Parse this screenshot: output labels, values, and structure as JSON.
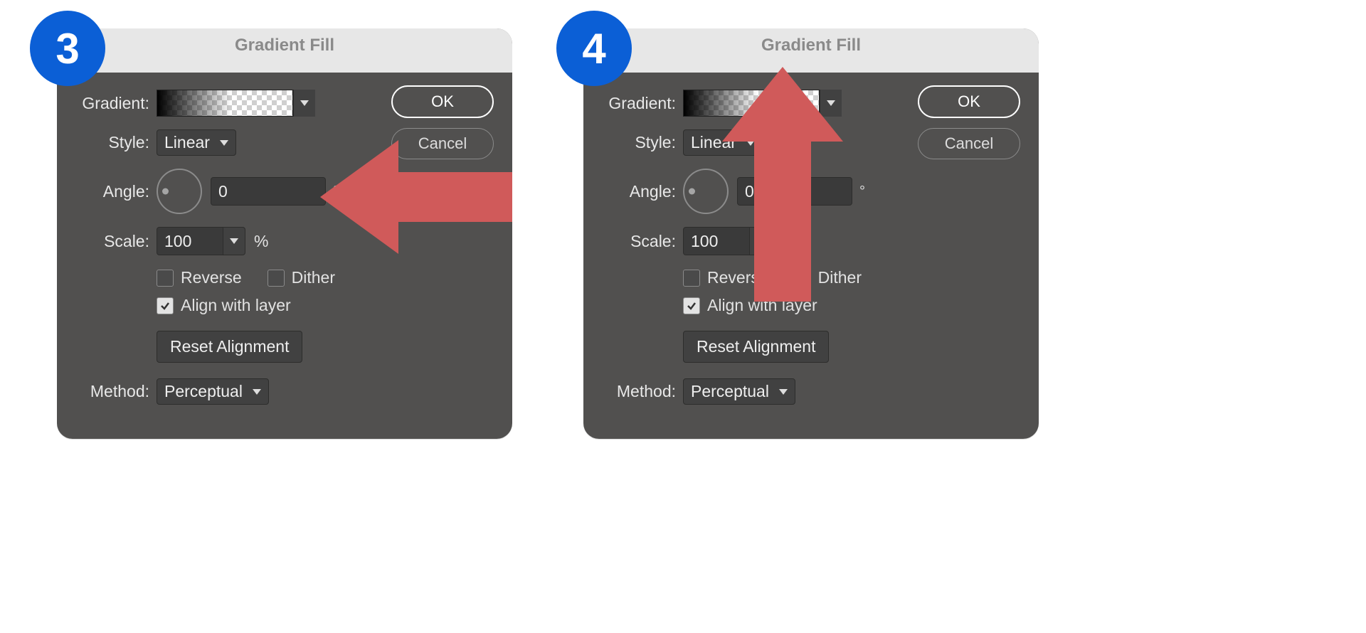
{
  "steps": [
    {
      "badge": "3",
      "arrow": "left"
    },
    {
      "badge": "4",
      "arrow": "up"
    }
  ],
  "dialog": {
    "title": "Gradient Fill",
    "labels": {
      "gradient": "Gradient:",
      "style": "Style:",
      "angle": "Angle:",
      "scale": "Scale:",
      "method": "Method:"
    },
    "values": {
      "style": "Linear",
      "angle": "0",
      "degree_symbol": "°",
      "scale": "100",
      "scale_unit": "%",
      "method": "Perceptual"
    },
    "checkboxes": {
      "reverse": {
        "label": "Reverse",
        "checked": false
      },
      "dither": {
        "label": "Dither",
        "checked": false
      },
      "align": {
        "label": "Align with layer",
        "checked": true
      }
    },
    "buttons": {
      "ok": "OK",
      "cancel": "Cancel",
      "reset": "Reset Alignment"
    }
  }
}
